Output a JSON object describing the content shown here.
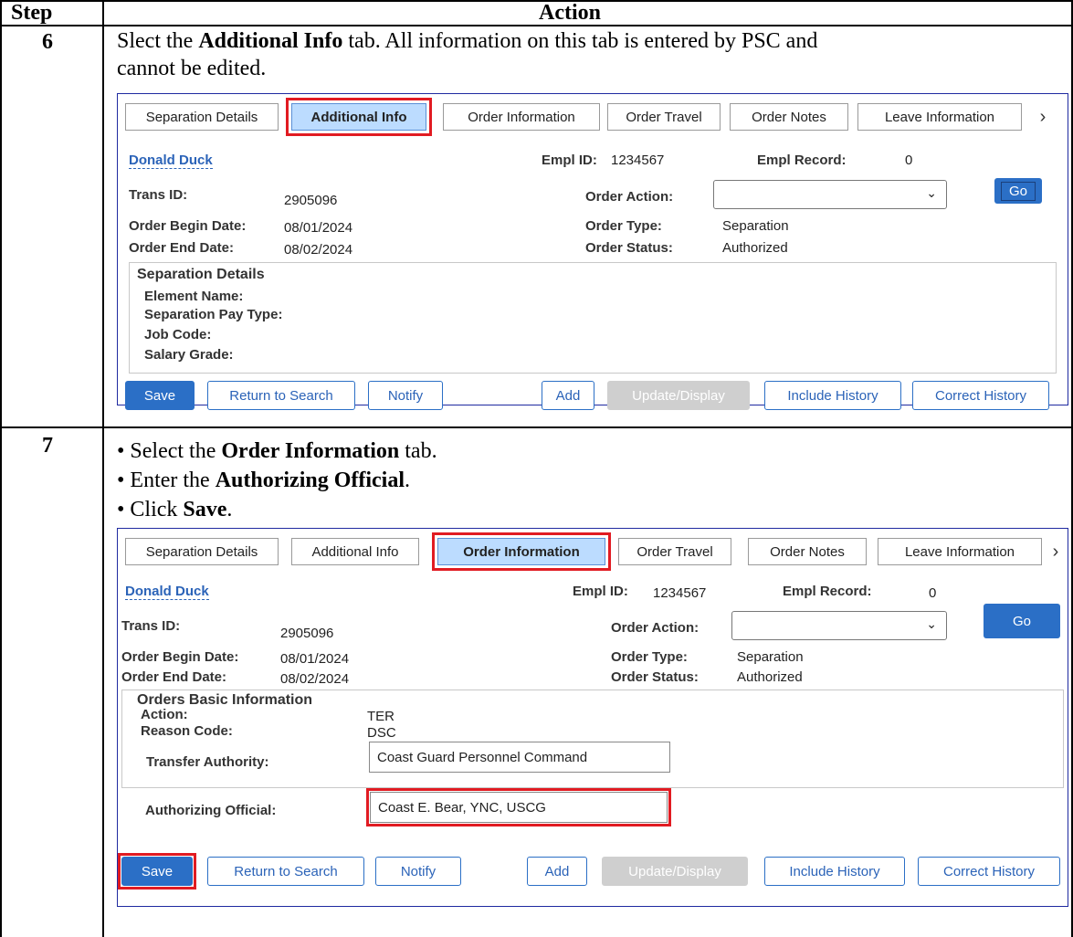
{
  "table": {
    "col_step": "Step",
    "col_action": "Action"
  },
  "step6": {
    "number": "6",
    "line1_pre": "Slect the ",
    "line1_bold": "Additional Info",
    "line1_post": " tab.  All information on this tab is entered by PSC and",
    "line2": "cannot be edited.",
    "tabs": [
      "Separation Details",
      "Additional Info",
      "Order Information",
      "Order Travel",
      "Order Notes",
      "Leave Information"
    ],
    "active_tab": "Additional Info",
    "employee_name": "Donald Duck",
    "empl_id_label": "Empl ID:",
    "empl_id": "1234567",
    "empl_record_label": "Empl Record:",
    "empl_record": "0",
    "trans_id_label": "Trans ID:",
    "trans_id": "2905096",
    "order_action_label": "Order Action:",
    "order_action_value": "",
    "go_label": "Go",
    "begin_label": "Order Begin Date:",
    "begin_value": "08/01/2024",
    "order_type_label": "Order Type:",
    "order_type_value": "Separation",
    "end_label": "Order End Date:",
    "end_value": "08/02/2024",
    "status_label": "Order Status:",
    "status_value": "Authorized",
    "group_title": "Separation Details",
    "group_fields": [
      "Element Name:",
      "Separation Pay Type:",
      "Job Code:",
      "Salary Grade:"
    ],
    "buttons": {
      "save": "Save",
      "return": "Return to Search",
      "notify": "Notify",
      "add": "Add",
      "update": "Update/Display",
      "include": "Include History",
      "correct": "Correct History"
    }
  },
  "step7": {
    "number": "7",
    "bullet1_pre": "Select the ",
    "bullet1_bold": "Order Information",
    "bullet1_post": " tab.",
    "bullet2_pre": "Enter the ",
    "bullet2_bold": "Authorizing Official",
    "bullet2_post": ".",
    "bullet3_pre": "Click ",
    "bullet3_bold": "Save",
    "bullet3_post": ".",
    "tabs": [
      "Separation Details",
      "Additional Info",
      "Order Information",
      "Order Travel",
      "Order Notes",
      "Leave Information"
    ],
    "active_tab": "Order Information",
    "employee_name": "Donald Duck",
    "empl_id_label": "Empl ID:",
    "empl_id": "1234567",
    "empl_record_label": "Empl Record:",
    "empl_record": "0",
    "trans_id_label": "Trans ID:",
    "trans_id": "2905096",
    "order_action_label": "Order Action:",
    "order_action_value": "",
    "go_label": "Go",
    "begin_label": "Order Begin Date:",
    "begin_value": "08/01/2024",
    "order_type_label": "Order Type:",
    "order_type_value": "Separation",
    "end_label": "Order End Date:",
    "end_value": "08/02/2024",
    "status_label": "Order Status:",
    "status_value": "Authorized",
    "group_title": "Orders Basic Information",
    "action_label": "Action:",
    "action_value": "TER",
    "reason_label": "Reason Code:",
    "reason_value": "DSC",
    "transfer_label": "Transfer Authority:",
    "transfer_value": "Coast Guard Personnel Command",
    "authorizing_label": "Authorizing Official:",
    "authorizing_value": "Coast E. Bear, YNC, USCG",
    "buttons": {
      "save": "Save",
      "return": "Return to Search",
      "notify": "Notify",
      "add": "Add",
      "update": "Update/Display",
      "include": "Include History",
      "correct": "Correct History"
    }
  },
  "colors": {
    "highlight": "#e11b22",
    "active_tab": "#bcdcff",
    "primary_button": "#2b6fc6",
    "link": "#2b63b8",
    "panel_border": "#1f2aa0"
  },
  "icons": {
    "dropdown": "chevron-down-icon",
    "tab_scroll": "chevron-right-icon"
  }
}
